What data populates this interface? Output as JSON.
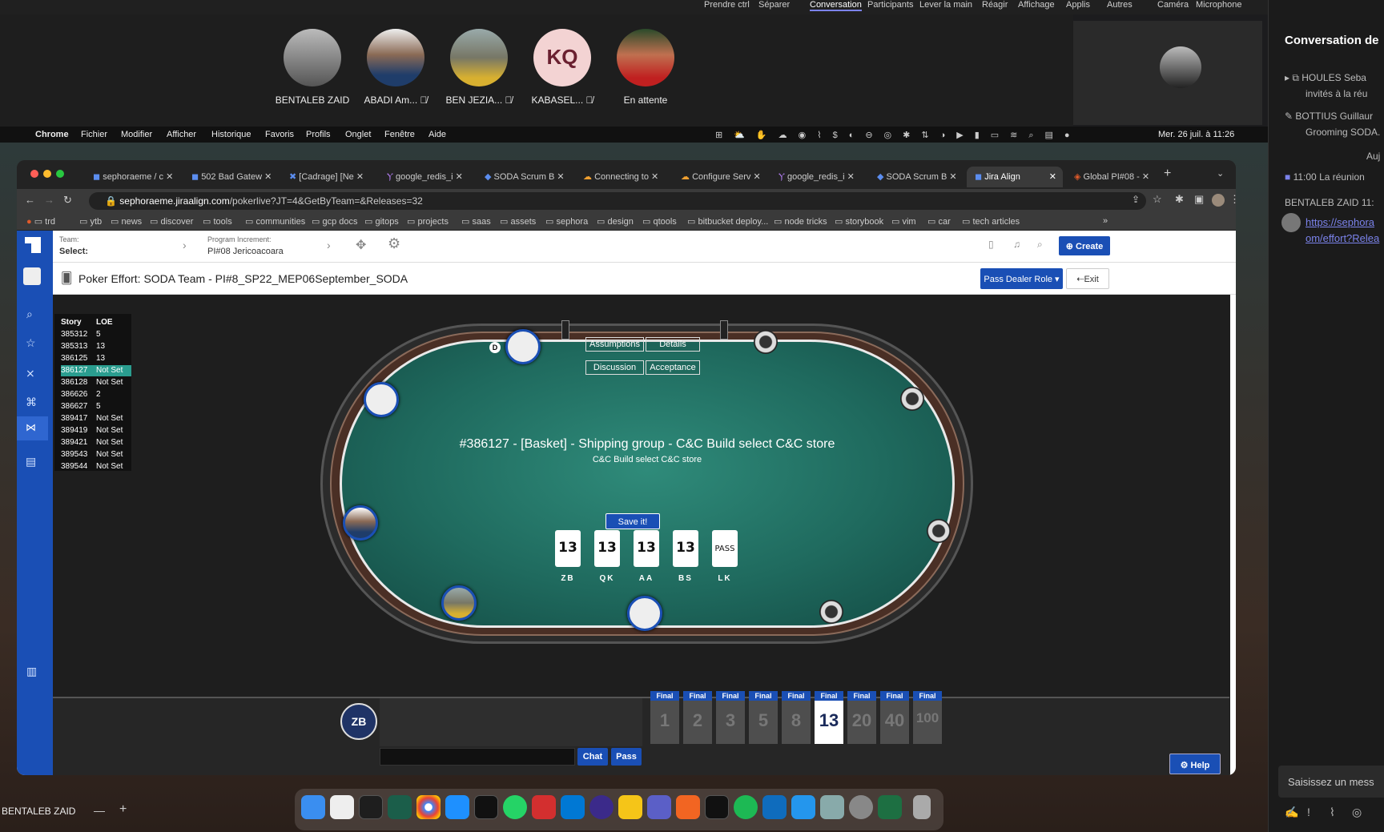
{
  "teams": {
    "top_menu": [
      "Prendre ctrl",
      "Séparer",
      "Conversation",
      "Participants",
      "Lever la main",
      "Réagir",
      "Affichage",
      "Applis",
      "Autres",
      "Caméra",
      "Microphone"
    ],
    "participants": [
      {
        "name": "BENTALEB ZAID",
        "initials": "",
        "muted": false
      },
      {
        "name": "ABADI Am...",
        "initials": "",
        "muted": true
      },
      {
        "name": "BEN JEZIA...",
        "initials": "",
        "muted": true
      },
      {
        "name": "KABASEL...",
        "initials": "KQ",
        "muted": true
      },
      {
        "name": "En attente",
        "initials": "",
        "muted": false
      }
    ],
    "self_name": "BENTALEB ZAID"
  },
  "chat": {
    "title": "Conversation de",
    "msg1": "HOULES Seba",
    "msg1b": "invités à la réu",
    "msg2": "BOTTIUS Guillaur",
    "msg2b": "Grooming SODA.",
    "msg2c": "Auj",
    "meeting_time": "11:00",
    "meeting_txt": "La réunion",
    "sender": "BENTALEB ZAID",
    "sender_time": "11:",
    "link1": "https://sephora",
    "link2": "om/effort?Relea",
    "input_placeholder": "Saisissez un mess"
  },
  "mac": {
    "app": "Chrome",
    "menus": [
      "Fichier",
      "Modifier",
      "Afficher",
      "Historique",
      "Favoris",
      "Profils",
      "Onglet",
      "Fenêtre",
      "Aide"
    ],
    "clock": "Mer. 26 juil. à 11:26"
  },
  "browser": {
    "tabs": [
      "sephoraeme / c",
      "502 Bad Gatew",
      "[Cadrage] [Ne",
      "google_redis_i",
      "SODA Scrum B",
      "Connecting to",
      "Configure Serv",
      "google_redis_i",
      "SODA Scrum B",
      "Jira Align",
      "Global PI#08 -"
    ],
    "url_host": "sephoraeme.jiraalign.com",
    "url_path": "/pokerlive?JT=4&GetByTeam=&Releases=32",
    "bookmarks": [
      "trd",
      "ytb",
      "news",
      "discover",
      "tools",
      "communities",
      "gcp docs",
      "gitops",
      "projects",
      "saas",
      "assets",
      "sephora",
      "design",
      "qtools",
      "bitbucket deploy...",
      "node tricks",
      "storybook",
      "vim",
      "car",
      "tech articles"
    ]
  },
  "app": {
    "team_label": "Team:",
    "team_value": "Select:",
    "pi_label": "Program Increment:",
    "pi_value": "PI#08 Jericoacoara",
    "create": "Create",
    "page_title": "Poker Effort: SODA Team - PI#8_SP22_MEP06September_SODA",
    "pass_dealer": "Pass Dealer Role",
    "exit": "Exit",
    "story_header": [
      "Story",
      "LOE"
    ],
    "stories": [
      [
        "385312",
        "5"
      ],
      [
        "385313",
        "13"
      ],
      [
        "386125",
        "13"
      ],
      [
        "386127",
        "Not Set"
      ],
      [
        "386128",
        "Not Set"
      ],
      [
        "386626",
        "2"
      ],
      [
        "386627",
        "5"
      ],
      [
        "389417",
        "Not Set"
      ],
      [
        "389419",
        "Not Set"
      ],
      [
        "389421",
        "Not Set"
      ],
      [
        "389543",
        "Not Set"
      ],
      [
        "389544",
        "Not Set"
      ]
    ],
    "selected_story": "386127",
    "felt_buttons": [
      "Assumptions",
      "Details",
      "Discussion",
      "Acceptance"
    ],
    "story_title": "#386127 - [Basket] - Shipping group - C&C Build select C&C store",
    "story_sub": "C&C Build select C&C store",
    "dealer_marker": "D",
    "save": "Save it!",
    "votes": [
      {
        "v": "13",
        "who": "ZB"
      },
      {
        "v": "13",
        "who": "QK"
      },
      {
        "v": "13",
        "who": "AA"
      },
      {
        "v": "13",
        "who": "BS"
      },
      {
        "v": "PASS",
        "who": "LK"
      }
    ],
    "me": "ZB",
    "chat_btn": "Chat",
    "pass_btn": "Pass",
    "help": "Help",
    "final_label": "Final",
    "choice_cards": [
      "1",
      "2",
      "3",
      "5",
      "8",
      "13",
      "20",
      "40",
      "100"
    ],
    "selected_card": "13"
  },
  "colors": {
    "brand": "#1a4fb5",
    "felt": "#1f6a5e"
  }
}
